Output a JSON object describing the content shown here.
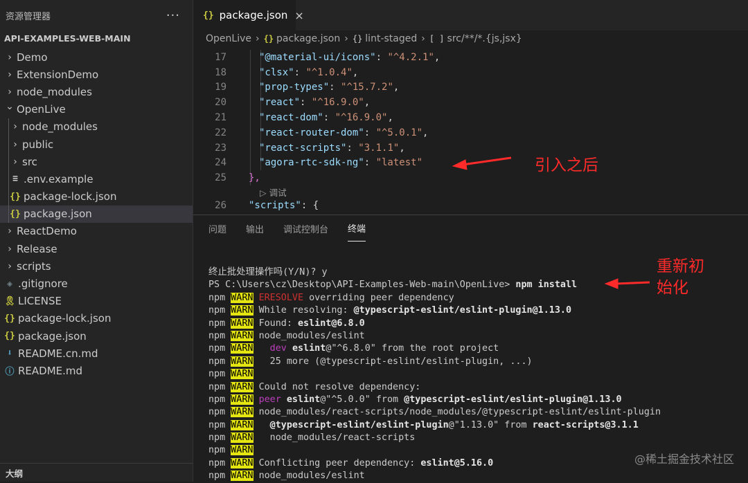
{
  "sidebar": {
    "title": "资源管理器",
    "more_label": "···",
    "project": "API-EXAMPLES-WEB-MAIN",
    "items": [
      {
        "label": "Demo",
        "depth": 0,
        "kind": "folder",
        "state": "closed"
      },
      {
        "label": "ExtensionDemo",
        "depth": 0,
        "kind": "folder",
        "state": "closed"
      },
      {
        "label": "node_modules",
        "depth": 0,
        "kind": "folder",
        "state": "closed"
      },
      {
        "label": "OpenLive",
        "depth": 0,
        "kind": "folder",
        "state": "open"
      },
      {
        "label": "node_modules",
        "depth": 1,
        "kind": "folder",
        "state": "closed"
      },
      {
        "label": "public",
        "depth": 1,
        "kind": "folder",
        "state": "closed"
      },
      {
        "label": "src",
        "depth": 1,
        "kind": "folder",
        "state": "closed"
      },
      {
        "label": ".env.example",
        "depth": 1,
        "kind": "env"
      },
      {
        "label": "package-lock.json",
        "depth": 1,
        "kind": "json"
      },
      {
        "label": "package.json",
        "depth": 1,
        "kind": "json",
        "selected": true
      },
      {
        "label": "ReactDemo",
        "depth": 0,
        "kind": "folder",
        "state": "closed"
      },
      {
        "label": "Release",
        "depth": 0,
        "kind": "folder",
        "state": "closed"
      },
      {
        "label": "scripts",
        "depth": 0,
        "kind": "folder",
        "state": "closed"
      },
      {
        "label": ".gitignore",
        "depth": 0,
        "kind": "git"
      },
      {
        "label": "LICENSE",
        "depth": 0,
        "kind": "license"
      },
      {
        "label": "package-lock.json",
        "depth": 0,
        "kind": "json"
      },
      {
        "label": "package.json",
        "depth": 0,
        "kind": "json"
      },
      {
        "label": "README.cn.md",
        "depth": 0,
        "kind": "md"
      },
      {
        "label": "README.md",
        "depth": 0,
        "kind": "info"
      }
    ],
    "outline_label": "大纲"
  },
  "icons": {
    "json": "{}",
    "env": "≡",
    "git": "◈",
    "license": "🎗",
    "md": "⬇",
    "info": "ⓘ",
    "chevron_right": "›",
    "chevron_down": "⌄",
    "close": "×",
    "json_color": "#cbcb41",
    "env_color": "#cccccc",
    "git_color": "#6d8086",
    "license_color": "#cbcb41",
    "md_color": "#519aba",
    "info_color": "#519aba"
  },
  "editor": {
    "tab": {
      "icon": "{}",
      "label": "package.json",
      "close": "×"
    },
    "breadcrumb": {
      "root": "OpenLive",
      "file_icon": "{}",
      "file": "package.json",
      "obj_icon": "{}",
      "obj": "lint-staged",
      "arr_icon": "[ ]",
      "arr": "src/**/*.{js,jsx}"
    },
    "lines": [
      {
        "n": "17",
        "key": "\"@material-ui/icons\"",
        "val": "\"^4.2.1\"",
        "tail": ","
      },
      {
        "n": "18",
        "key": "\"clsx\"",
        "val": "\"^1.0.4\"",
        "tail": ","
      },
      {
        "n": "19",
        "key": "\"prop-types\"",
        "val": "\"^15.7.2\"",
        "tail": ","
      },
      {
        "n": "20",
        "key": "\"react\"",
        "val": "\"^16.9.0\"",
        "tail": ","
      },
      {
        "n": "21",
        "key": "\"react-dom\"",
        "val": "\"^16.9.0\"",
        "tail": ","
      },
      {
        "n": "22",
        "key": "\"react-router-dom\"",
        "val": "\"^5.0.1\"",
        "tail": ","
      },
      {
        "n": "23",
        "key": "\"react-scripts\"",
        "val": "\"3.1.1\"",
        "tail": ","
      },
      {
        "n": "24",
        "key": "\"agora-rtc-sdk-ng\"",
        "val": "\"latest\"",
        "tail": ""
      }
    ],
    "line25": {
      "n": "25",
      "text": "},"
    },
    "codelens": "▷ 调试",
    "line26": {
      "n": "26",
      "key": "\"scripts\"",
      "tail": ": {"
    }
  },
  "panel": {
    "tabs": [
      "问题",
      "输出",
      "调试控制台",
      "终端"
    ],
    "active_tab": "终端",
    "terminal": {
      "prompt_confirm": "终止批处理操作吗(Y/N)? y",
      "prompt_path": "PS C:\\Users\\cz\\Desktop\\API-Examples-Web-main\\OpenLive>",
      "prompt_cmd": "npm install",
      "npm": "npm",
      "warn": "WARN",
      "l1a": "ERESOLVE",
      "l1b": " overriding peer dependency",
      "l2a": "While resolving: ",
      "l2b": "@typescript-eslint/eslint-plugin@1.13.0",
      "l3a": "Found: ",
      "l3b": "eslint@6.8.0",
      "l4": "node_modules/eslint",
      "l5a": "  dev ",
      "l5b": "eslint",
      "l5c": "@\"^6.8.0\" from the root project",
      "l6": "  25 more (@typescript-eslint/eslint-plugin, ...)",
      "l8": "Could not resolve dependency:",
      "l9a": "peer ",
      "l9b": "eslint",
      "l9c": "@\"^5.0.0\" from ",
      "l9d": "@typescript-eslint/eslint-plugin@1.13.0",
      "l10": "node_modules/react-scripts/node_modules/@typescript-eslint/eslint-plugin",
      "l11a": "  @typescript-eslint/eslint-plugin",
      "l11b": "@\"1.13.0\" from ",
      "l11c": "react-scripts@3.1.1",
      "l12": "  node_modules/react-scripts",
      "l14a": "Conflicting peer dependency: ",
      "l14b": "eslint@5.16.0",
      "l15": "node_modules/eslint"
    }
  },
  "annotations": {
    "after_import": "引入之后",
    "reinit": "重新初\n始化",
    "color": "#ff2a2a"
  },
  "watermark": "@稀土掘金技术社区"
}
